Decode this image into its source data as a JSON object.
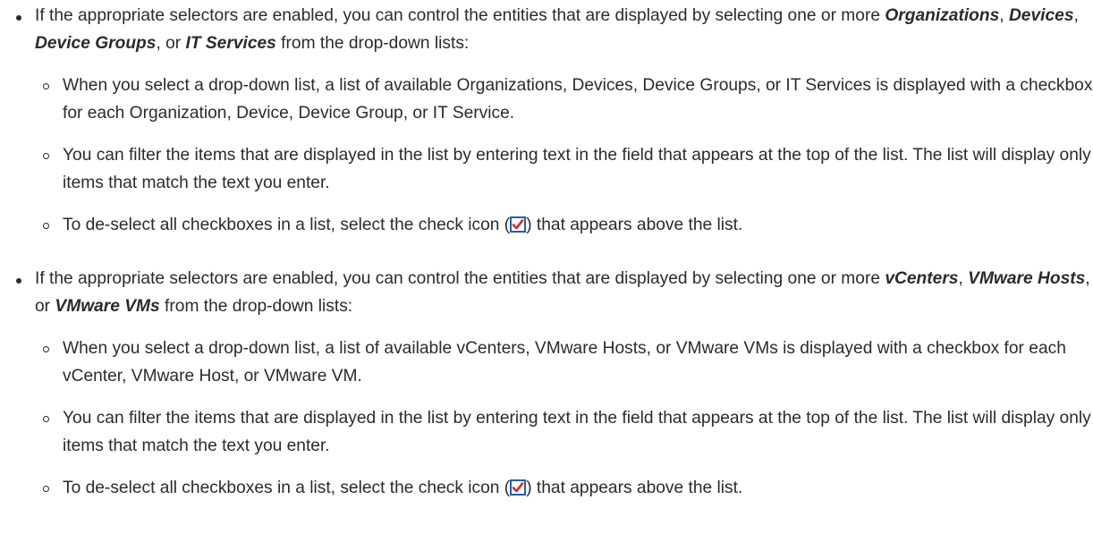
{
  "sections": [
    {
      "intro_before": "If the appropriate selectors are enabled, you can control the entities that are displayed by selecting one or more ",
      "term_1": "Organizations",
      "sep_1": ", ",
      "term_2": "Devices",
      "sep_2": ", ",
      "term_3": "Device Groups",
      "sep_3": ", or ",
      "term_4": "IT Services",
      "intro_after": " from the drop-down lists:",
      "sub": [
        "When you select a drop-down list, a list of available Organizations, Devices, Device Groups, or IT Services is displayed with a checkbox for each Organization, Device, Device Group, or IT Service.",
        "You can filter the items that are displayed in the list by entering text in the field that appears at the top of the list. The list will display only items that match the text you enter."
      ],
      "deselect_before": "To de-select all checkboxes in a list, select the check icon (",
      "deselect_after": ") that appears above the list."
    },
    {
      "intro_before": "If the appropriate selectors are enabled, you can control the entities that are displayed by selecting one or more ",
      "term_1": "vCenters",
      "sep_1": ", ",
      "term_2": "VMware Hosts",
      "sep_2": ", or ",
      "term_3": "VMware VMs",
      "intro_after": " from the drop-down lists:",
      "sub": [
        "When you select a drop-down list, a list of available vCenters, VMware Hosts, or VMware VMs is displayed with a checkbox for each vCenter, VMware Host, or VMware VM.",
        "You can filter the items that are displayed in the list by entering text in the field that appears at the top of the list. The list will display only items that match the text you enter."
      ],
      "deselect_before": "To de-select all checkboxes in a list, select the check icon (",
      "deselect_after": ") that appears above the list."
    }
  ],
  "icons": {
    "check_icon": "checkbox-check-icon"
  },
  "colors": {
    "text": "#2b2b2b",
    "icon_border": "#1f5fb0",
    "icon_check": "#d62a1e"
  }
}
